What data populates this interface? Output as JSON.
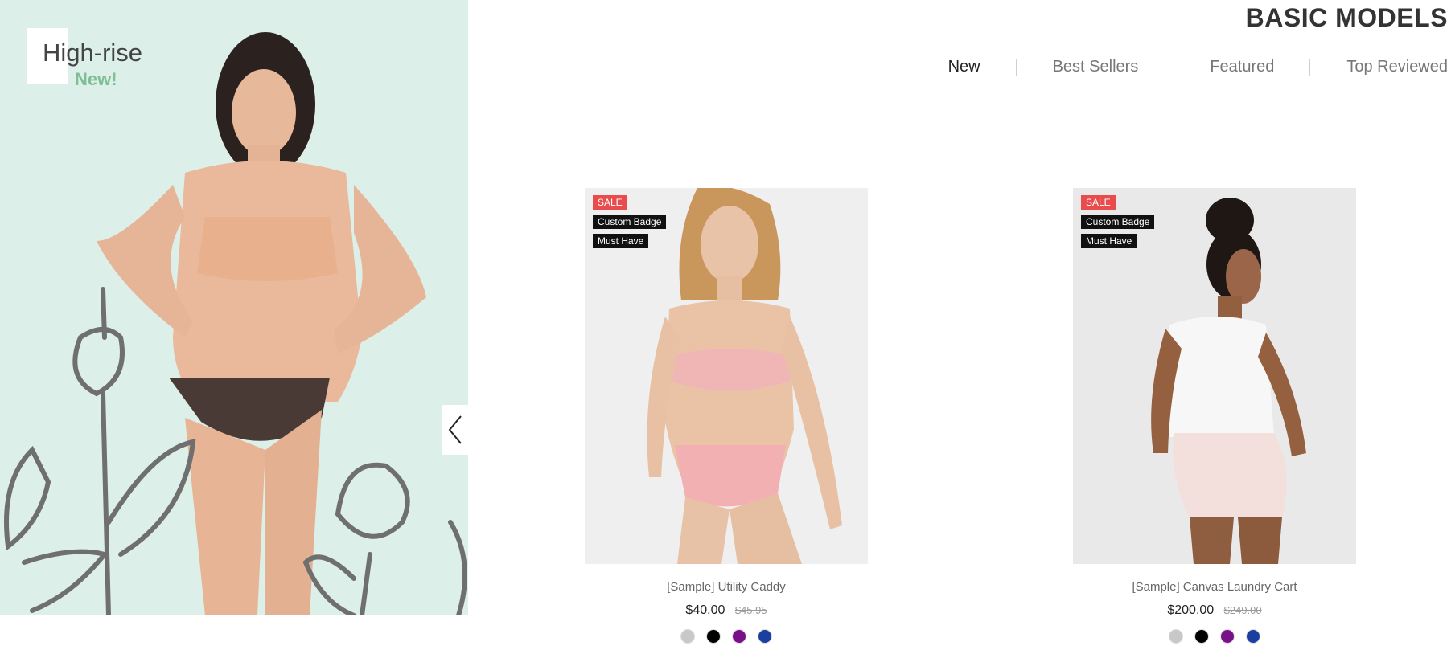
{
  "banner": {
    "title": "High-rise",
    "subtitle": "New!",
    "background_color": "#dcefe9",
    "accent_color": "#7fbf95",
    "prev_icon": "chevron-left-icon"
  },
  "section": {
    "title": "BASIC MODELS"
  },
  "tabs": [
    {
      "label": "New",
      "active": true
    },
    {
      "label": "Best Sellers",
      "active": false
    },
    {
      "label": "Featured",
      "active": false
    },
    {
      "label": "Top Reviewed",
      "active": false
    }
  ],
  "products": [
    {
      "badges": {
        "sale": "SALE",
        "custom": "Custom Badge",
        "must": "Must Have"
      },
      "name": "[Sample] Utility Caddy",
      "price": "$40.00",
      "old_price": "$45.95",
      "swatches": [
        "#c8c8c8",
        "#000000",
        "#7a0f8a",
        "#1a3fa0"
      ]
    },
    {
      "badges": {
        "sale": "SALE",
        "custom": "Custom Badge",
        "must": "Must Have"
      },
      "name": "[Sample] Canvas Laundry Cart",
      "price": "$200.00",
      "old_price": "$249.00",
      "swatches": [
        "#c8c8c8",
        "#000000",
        "#7a0f8a",
        "#1a3fa0"
      ]
    }
  ],
  "colors": {
    "sale_badge": "#e84c4c",
    "dark_badge": "#111111"
  }
}
